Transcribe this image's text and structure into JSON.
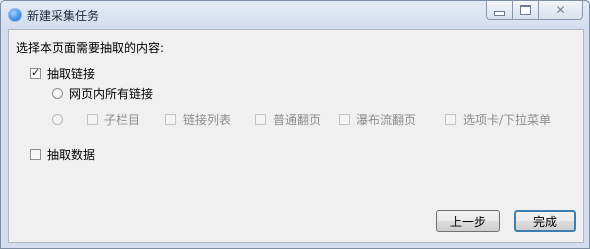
{
  "window": {
    "title": "新建采集任务",
    "controls": {
      "minimize_icon": "minimize-icon",
      "maximize_icon": "maximize-icon",
      "close_icon": "close-icon",
      "close_glyph": "✕"
    }
  },
  "content": {
    "prompt": "选择本页面需要抽取的内容:",
    "extract_links": {
      "label": "抽取链接",
      "checked": true,
      "check_glyph": "✓",
      "options": {
        "all_links_label": "网页内所有链接",
        "sub_options": [
          {
            "label": "子栏目",
            "enabled": false
          },
          {
            "label": "链接列表",
            "enabled": false
          },
          {
            "label": "普通翻页",
            "enabled": false
          },
          {
            "label": "瀑布流翻页",
            "enabled": false
          },
          {
            "label": "选项卡/下拉菜单",
            "enabled": false
          }
        ]
      }
    },
    "extract_data": {
      "label": "抽取数据",
      "checked": false
    }
  },
  "footer": {
    "back_label": "上一步",
    "finish_label": "完成"
  },
  "colors": {
    "accent": "#3c7fb1",
    "disabled_text": "#8d8d8d"
  }
}
